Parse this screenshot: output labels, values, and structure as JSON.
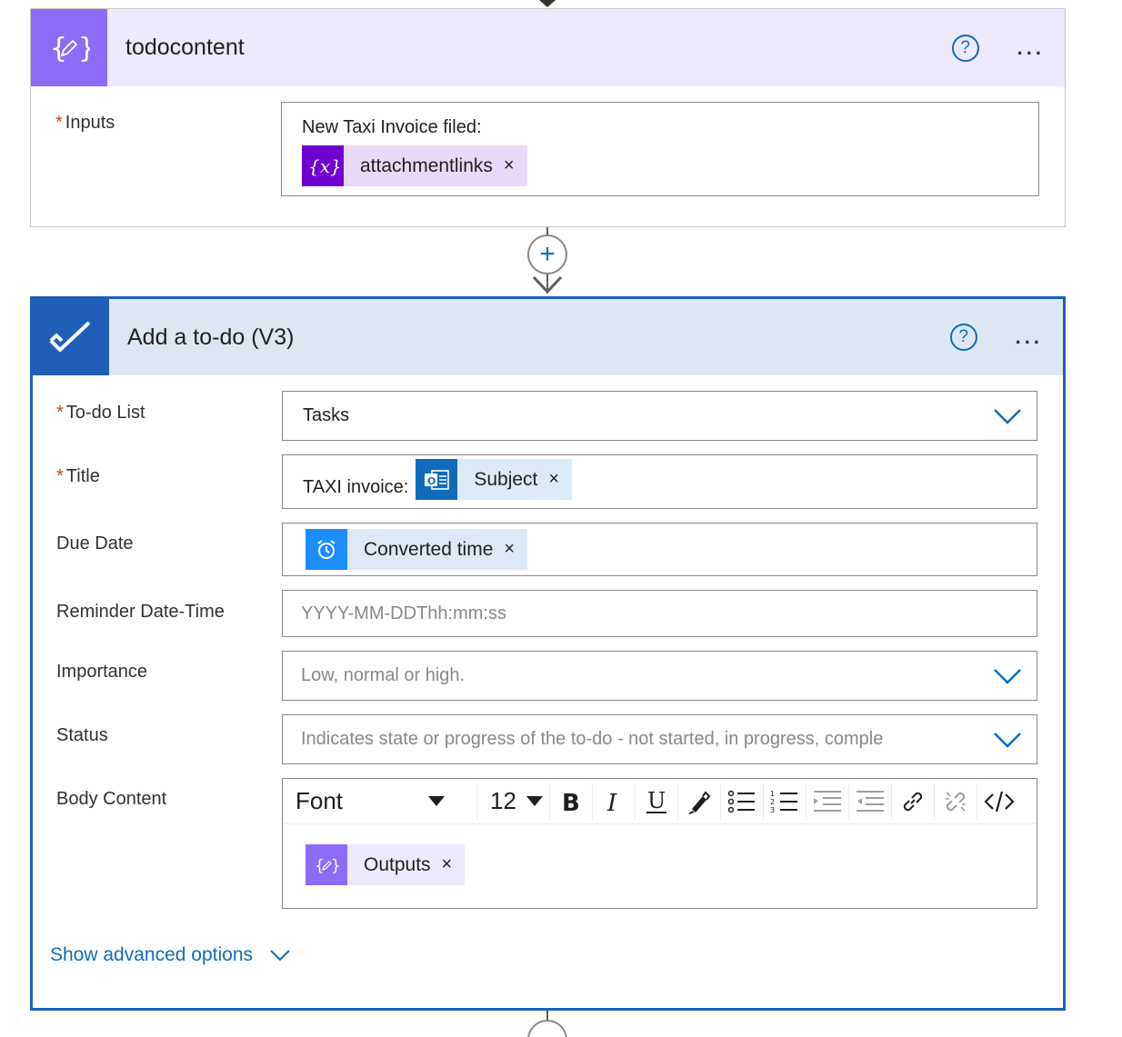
{
  "card1": {
    "title": "todocontent",
    "help_label": "?",
    "more_label": "...",
    "inputs": {
      "label": "Inputs",
      "required_mark": "*",
      "text": "New Taxi  Invoice filed:",
      "token": {
        "label": "attachmentlinks",
        "remove": "×",
        "icon": "variable-icon",
        "color": "#6f00cf",
        "bg": "#e9d9f8"
      }
    }
  },
  "connector": {
    "plus_label": "+"
  },
  "card2": {
    "title": "Add a to-do (V3)",
    "help_label": "?",
    "more_label": "...",
    "fields": {
      "todo_list": {
        "label": "To-do List",
        "required_mark": "*",
        "value": "Tasks"
      },
      "title": {
        "label": "Title",
        "required_mark": "*",
        "prefix": "TAXI invoice:",
        "token": {
          "label": "Subject",
          "remove": "×",
          "icon": "outlook-icon",
          "color": "#0f6cbd",
          "bg": "#dceaf7"
        }
      },
      "due_date": {
        "label": "Due Date",
        "token": {
          "label": "Converted time",
          "remove": "×",
          "icon": "alarm-clock-icon",
          "color": "#1c8dff",
          "bg": "#dceaf7"
        }
      },
      "reminder": {
        "label": "Reminder Date-Time",
        "placeholder": "YYYY-MM-DDThh:mm:ss"
      },
      "importance": {
        "label": "Importance",
        "placeholder": "Low, normal or high."
      },
      "status": {
        "label": "Status",
        "placeholder": "Indicates state or progress of the to-do - not started, in progress, comple"
      },
      "body": {
        "label": "Body Content",
        "font_label": "Font",
        "size_label": "12",
        "token": {
          "label": "Outputs",
          "remove": "×",
          "icon": "compose-icon",
          "color": "#8c6cf7",
          "bg": "#eee9fd"
        }
      }
    },
    "advanced_label": "Show advanced options"
  },
  "colors": {
    "link": "#0f6cbd",
    "card2_border": "#1f5fb8",
    "card1_header": "#eee9fd",
    "card2_header": "#dde7f4"
  }
}
